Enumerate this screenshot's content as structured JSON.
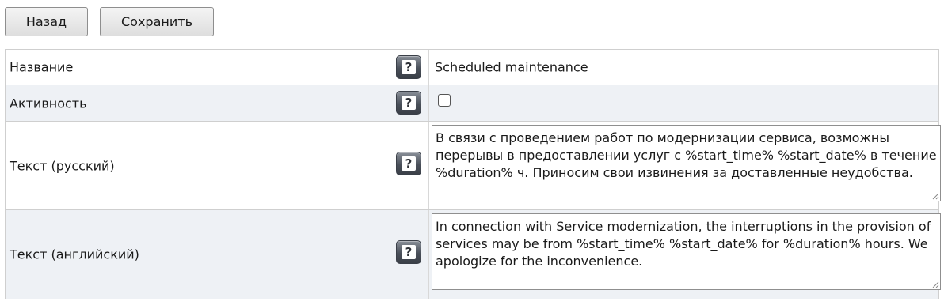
{
  "toolbar": {
    "back_label": "Назад",
    "save_label": "Сохранить"
  },
  "form": {
    "name": {
      "label": "Название",
      "value": "Scheduled maintenance"
    },
    "active": {
      "label": "Активность",
      "checked": false
    },
    "text_ru": {
      "label": "Текст (русский)",
      "value": "В связи с проведением работ по модернизации сервиса, возможны перерывы в предоставлении услуг с %start_time% %start_date% в течение %duration% ч. Приносим свои извинения за доставленные неудобства."
    },
    "text_en": {
      "label": "Текст (английский)",
      "value": "In connection with Service modernization, the interruptions in the provision of services may be from %start_time% %start_date% for %duration% hours. We apologize for the inconvenience."
    },
    "help_icon": "?"
  }
}
